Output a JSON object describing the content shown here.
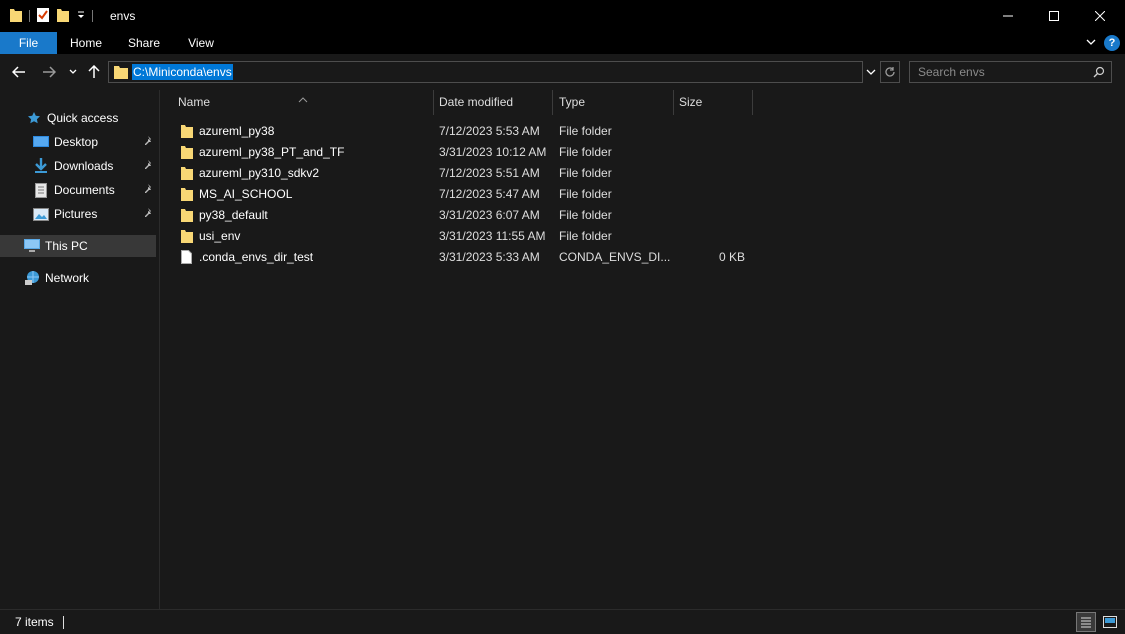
{
  "window": {
    "title": "envs",
    "minimize_icon": "minimize-icon",
    "maximize_icon": "maximize-icon",
    "close_icon": "close-icon"
  },
  "ribbon": {
    "tabs": [
      {
        "label": "File",
        "active": true
      },
      {
        "label": "Home"
      },
      {
        "label": "Share"
      },
      {
        "label": "View"
      }
    ],
    "accent": "#1979ca",
    "help_label": "?"
  },
  "address": {
    "path": "C:\\Miniconda\\envs",
    "search_placeholder": "Search envs"
  },
  "navpane": {
    "quick_access": "Quick access",
    "pinned": [
      {
        "label": "Desktop",
        "icon": "desktop-icon"
      },
      {
        "label": "Downloads",
        "icon": "downloads-icon"
      },
      {
        "label": "Documents",
        "icon": "documents-icon"
      },
      {
        "label": "Pictures",
        "icon": "pictures-icon"
      }
    ],
    "this_pc": "This PC",
    "network": "Network"
  },
  "columns": {
    "name": "Name",
    "date": "Date modified",
    "type": "Type",
    "size": "Size"
  },
  "files": [
    {
      "name": "azureml_py38",
      "date": "7/12/2023 5:53 AM",
      "type": "File folder",
      "size": "",
      "icon": "folder-icon"
    },
    {
      "name": "azureml_py38_PT_and_TF",
      "date": "3/31/2023 10:12 AM",
      "type": "File folder",
      "size": "",
      "icon": "folder-icon"
    },
    {
      "name": "azureml_py310_sdkv2",
      "date": "7/12/2023 5:51 AM",
      "type": "File folder",
      "size": "",
      "icon": "folder-icon"
    },
    {
      "name": "MS_AI_SCHOOL",
      "date": "7/12/2023 5:47 AM",
      "type": "File folder",
      "size": "",
      "icon": "folder-icon"
    },
    {
      "name": "py38_default",
      "date": "3/31/2023 6:07 AM",
      "type": "File folder",
      "size": "",
      "icon": "folder-icon"
    },
    {
      "name": "usi_env",
      "date": "3/31/2023 11:55 AM",
      "type": "File folder",
      "size": "",
      "icon": "folder-icon"
    },
    {
      "name": ".conda_envs_dir_test",
      "date": "3/31/2023 5:33 AM",
      "type": "CONDA_ENVS_DI...",
      "size": "0 KB",
      "icon": "file-icon"
    }
  ],
  "status": {
    "item_count": "7 items"
  },
  "colors": {
    "background": "#191919",
    "titlebar": "#000000",
    "selection": "#0078d7",
    "folder": "#f8d775"
  }
}
